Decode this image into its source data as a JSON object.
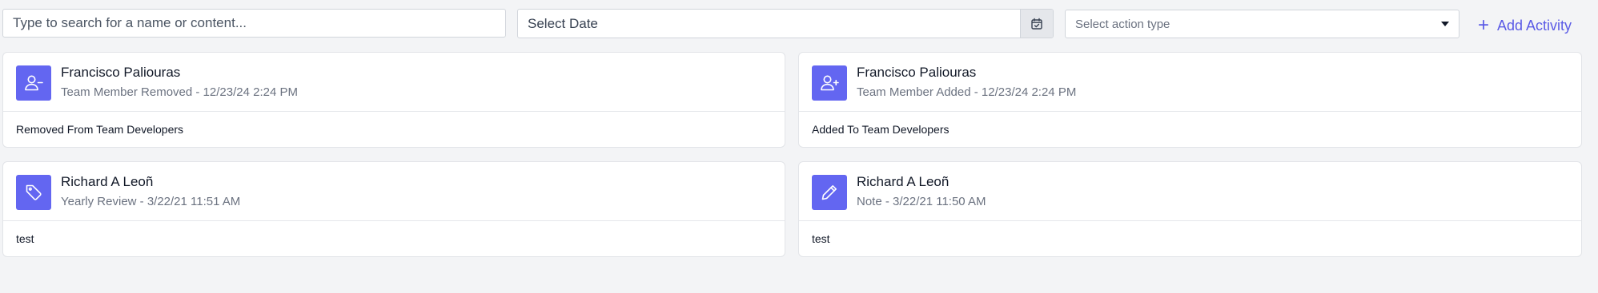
{
  "filters": {
    "search_placeholder": "Type to search for a name or content...",
    "date_placeholder": "Select Date",
    "calendar_icon": "calendar-check-icon",
    "action_type_placeholder": "Select action type",
    "add_activity_label": "Add Activity"
  },
  "colors": {
    "accent": "#6366f1",
    "link": "#5b5be6",
    "page_bg": "#f3f4f6"
  },
  "activities": [
    {
      "name": "Francisco Paliouras",
      "meta": "Team Member Removed - 12/23/24 2:24 PM",
      "body": "Removed From Team Developers",
      "icon": "user-minus-icon"
    },
    {
      "name": "Francisco Paliouras",
      "meta": "Team Member Added - 12/23/24 2:24 PM",
      "body": "Added To Team Developers",
      "icon": "user-plus-icon"
    },
    {
      "name": "Richard A Leoñ",
      "meta": "Yearly Review - 3/22/21 11:51 AM",
      "body": "test",
      "icon": "tag-icon"
    },
    {
      "name": "Richard A Leoñ",
      "meta": "Note - 3/22/21 11:50 AM",
      "body": "test",
      "icon": "pencil-icon"
    }
  ]
}
